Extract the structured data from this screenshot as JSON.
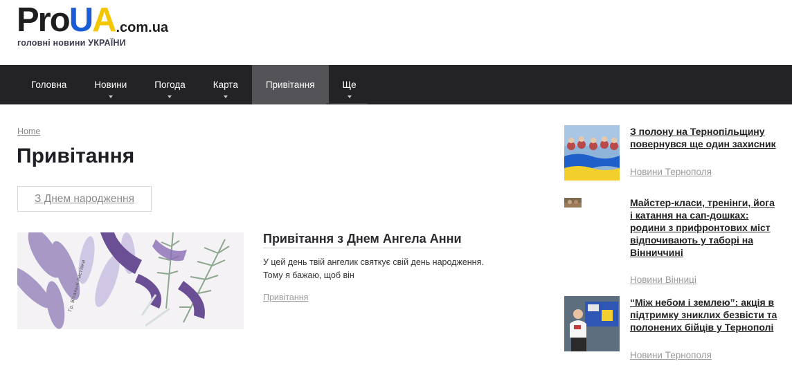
{
  "logo": {
    "pro": "Pro",
    "u": "U",
    "a": "A",
    "domain": ".com.ua",
    "tagline": "головні новини УКРАЇНИ"
  },
  "nav": {
    "items": [
      {
        "label": "Головна",
        "has_dropdown": false,
        "active": false
      },
      {
        "label": "Новини",
        "has_dropdown": true,
        "active": false
      },
      {
        "label": "Погода",
        "has_dropdown": true,
        "active": false
      },
      {
        "label": "Карта",
        "has_dropdown": true,
        "active": false
      },
      {
        "label": "Привітання",
        "has_dropdown": false,
        "active": true
      },
      {
        "label": "Ще",
        "has_dropdown": true,
        "active": false
      }
    ]
  },
  "breadcrumb": "Home",
  "page_title": "Привітання",
  "tag_filter": "З Днем народження",
  "article": {
    "title": "Привітання з Днем Ангела Анни",
    "excerpt_line1": "У цей день твій ангелик святкує свій день народження.",
    "excerpt_line2": "Тому я бажаю, щоб він",
    "category": "Привітання",
    "image_caption": "Гр. Вітальні листівки"
  },
  "sidebar": {
    "items": [
      {
        "title": "З полону на Тернопільщину повернувся ще один захисник",
        "category": "Новини Тернополя"
      },
      {
        "title": "Майстер-класи, тренінги, йога і катання на сап-дошках: родини з прифронтових міст відпочивають у таборі на Вінниччині",
        "category": "Новини Вінниці"
      },
      {
        "title": "“Між небом і землею”: акція в підтримку зниклих безвісти та полонених бійців у Тернополі",
        "category": "Новини Тернополя"
      }
    ]
  },
  "colors": {
    "nav_bg": "#232326",
    "nav_active": "#545357",
    "logo_blue": "#1a5bd6",
    "logo_yellow": "#f4c600"
  }
}
